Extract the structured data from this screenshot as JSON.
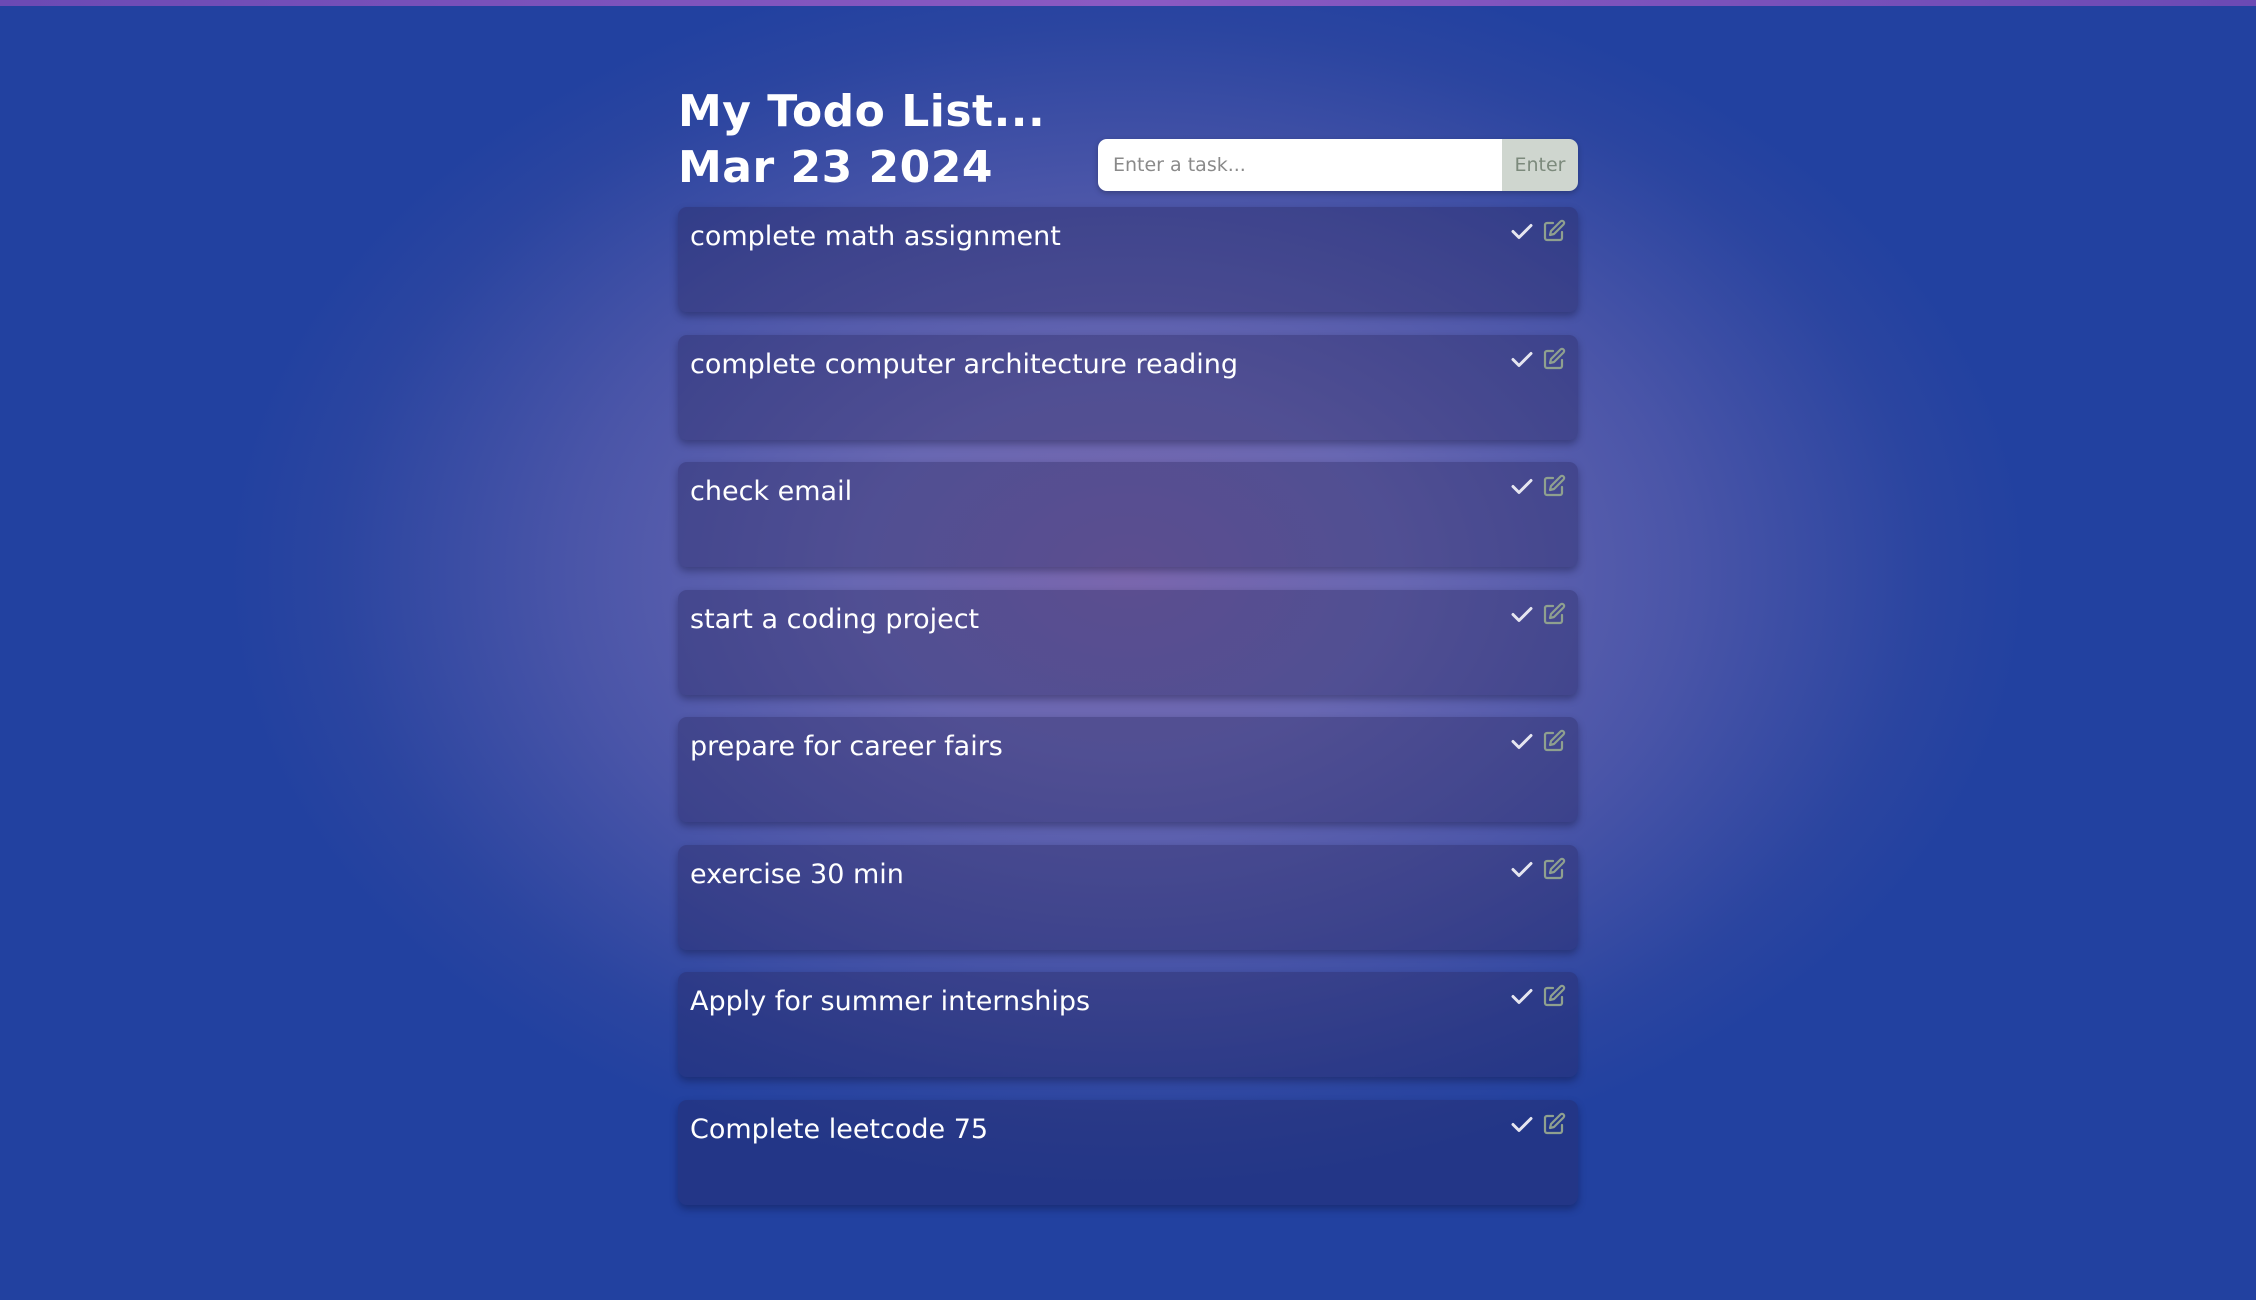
{
  "header": {
    "title_line1": "My Todo List...",
    "title_line2": "Mar 23 2024"
  },
  "form": {
    "placeholder": "Enter a task...",
    "input_value": "",
    "submit_label": "Enter"
  },
  "todos": [
    {
      "text": "complete math assignment"
    },
    {
      "text": "complete computer architecture reading"
    },
    {
      "text": "check email"
    },
    {
      "text": "start a coding project"
    },
    {
      "text": "prepare for career fairs"
    },
    {
      "text": "exercise 30 min"
    },
    {
      "text": "Apply for summer internships"
    },
    {
      "text": "Complete leetcode 75"
    }
  ],
  "icons": {
    "complete": "check-icon",
    "edit": "edit-icon"
  },
  "colors": {
    "check_icon": "#e6e6f0",
    "edit_icon": "#8fa08f",
    "enter_button_bg": "#cfd6cf",
    "enter_button_text": "#7c8a7c"
  }
}
